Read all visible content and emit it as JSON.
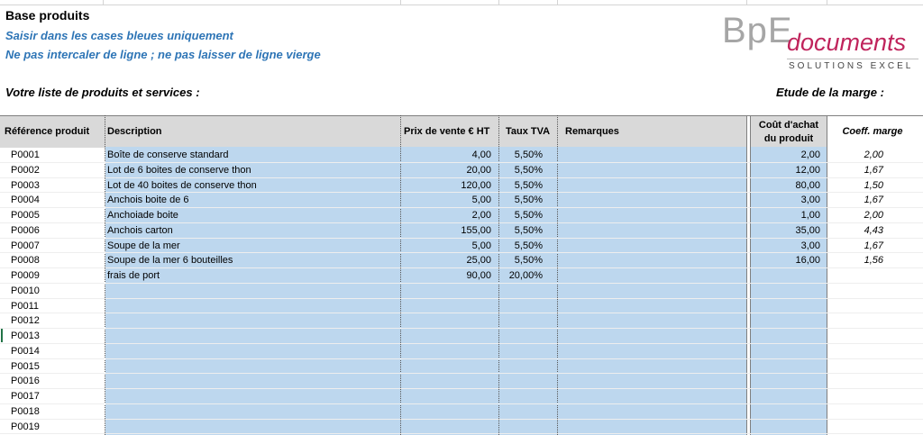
{
  "sheet": {
    "title": "Base produits",
    "instructions": [
      "Saisir dans les cases bleues uniquement",
      "Ne pas intercaler de ligne ; ne pas laisser de ligne vierge"
    ],
    "list_heading": "Votre liste de produits et services :",
    "margin_heading": "Etude de la marge :"
  },
  "logo": {
    "brand": "BpE",
    "product": "documents",
    "tagline": "SOLUTIONS EXCEL"
  },
  "colors": {
    "input_blue": "#bdd7ee",
    "header_grey": "#d9d9d9",
    "instruction_blue": "#2e75b6",
    "logo_magenta": "#c0245c"
  },
  "table": {
    "headers": {
      "reference": "Référence produit",
      "description": "Description",
      "price": "Prix de vente € HT",
      "vat": "Taux TVA",
      "remarks": "Remarques",
      "cost_line1": "Coût d'achat",
      "cost_line2": "du produit",
      "coeff": "Coeff. marge"
    },
    "rows": [
      {
        "ref": "P0001",
        "desc": "Boîte de conserve standard",
        "price": "4,00",
        "vat": "5,50%",
        "cost": "2,00",
        "coeff": "2,00"
      },
      {
        "ref": "P0002",
        "desc": "Lot de 6 boites de conserve thon",
        "price": "20,00",
        "vat": "5,50%",
        "cost": "12,00",
        "coeff": "1,67"
      },
      {
        "ref": "P0003",
        "desc": "Lot de 40 boites de conserve thon",
        "price": "120,00",
        "vat": "5,50%",
        "cost": "80,00",
        "coeff": "1,50"
      },
      {
        "ref": "P0004",
        "desc": "Anchois boite de 6",
        "price": "5,00",
        "vat": "5,50%",
        "cost": "3,00",
        "coeff": "1,67"
      },
      {
        "ref": "P0005",
        "desc": "Anchoiade boite",
        "price": "2,00",
        "vat": "5,50%",
        "cost": "1,00",
        "coeff": "2,00"
      },
      {
        "ref": "P0006",
        "desc": "Anchois carton",
        "price": "155,00",
        "vat": "5,50%",
        "cost": "35,00",
        "coeff": "4,43"
      },
      {
        "ref": "P0007",
        "desc": "Soupe de la mer",
        "price": "5,00",
        "vat": "5,50%",
        "cost": "3,00",
        "coeff": "1,67"
      },
      {
        "ref": "P0008",
        "desc": "Soupe de la mer 6 bouteilles",
        "price": "25,00",
        "vat": "5,50%",
        "cost": "16,00",
        "coeff": "1,56"
      },
      {
        "ref": "P0009",
        "desc": "frais de port",
        "price": "90,00",
        "vat": "20,00%",
        "cost": "",
        "coeff": ""
      },
      {
        "ref": "P0010",
        "desc": "",
        "price": "",
        "vat": "",
        "cost": "",
        "coeff": ""
      },
      {
        "ref": "P0011",
        "desc": "",
        "price": "",
        "vat": "",
        "cost": "",
        "coeff": ""
      },
      {
        "ref": "P0012",
        "desc": "",
        "price": "",
        "vat": "",
        "cost": "",
        "coeff": ""
      },
      {
        "ref": "P0013",
        "desc": "",
        "price": "",
        "vat": "",
        "cost": "",
        "coeff": ""
      },
      {
        "ref": "P0014",
        "desc": "",
        "price": "",
        "vat": "",
        "cost": "",
        "coeff": ""
      },
      {
        "ref": "P0015",
        "desc": "",
        "price": "",
        "vat": "",
        "cost": "",
        "coeff": ""
      },
      {
        "ref": "P0016",
        "desc": "",
        "price": "",
        "vat": "",
        "cost": "",
        "coeff": ""
      },
      {
        "ref": "P0017",
        "desc": "",
        "price": "",
        "vat": "",
        "cost": "",
        "coeff": ""
      },
      {
        "ref": "P0018",
        "desc": "",
        "price": "",
        "vat": "",
        "cost": "",
        "coeff": ""
      },
      {
        "ref": "P0019",
        "desc": "",
        "price": "",
        "vat": "",
        "cost": "",
        "coeff": ""
      }
    ]
  }
}
